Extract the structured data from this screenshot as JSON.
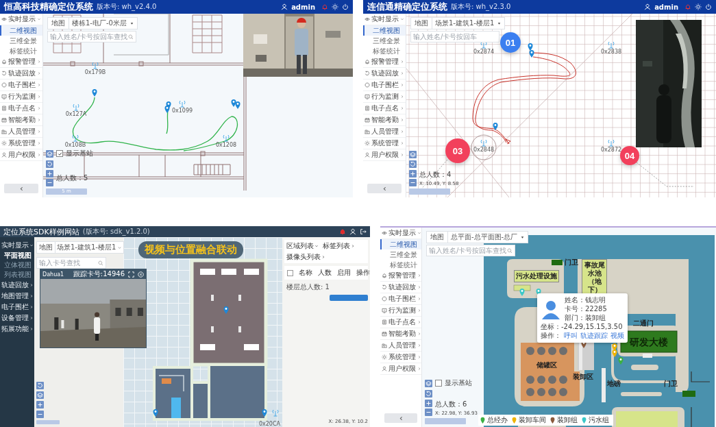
{
  "top_left": {
    "header": {
      "title": "恒高科技精确定位系统",
      "version": "版本号: wh_v2.4.0",
      "user": "admin"
    },
    "sidebar": {
      "groups": [
        {
          "label": "实时显示",
          "expanded": true,
          "children": [
            {
              "label": "二维视图",
              "selected": true
            },
            {
              "label": "三维全景",
              "selected": false
            },
            {
              "label": "标签统计",
              "selected": false
            }
          ]
        },
        {
          "label": "报警管理",
          "expanded": false
        },
        {
          "label": "轨迹回放",
          "expanded": false
        },
        {
          "label": "电子围栏",
          "expanded": false
        },
        {
          "label": "行为监测",
          "expanded": false
        },
        {
          "label": "电子点名",
          "expanded": false
        },
        {
          "label": "智能考勤",
          "expanded": false
        },
        {
          "label": "人员管理",
          "expanded": false
        },
        {
          "label": "系统管理",
          "expanded": false
        },
        {
          "label": "用户权限",
          "expanded": false
        }
      ]
    },
    "map_toolbar": {
      "label": "地图",
      "floor": "楼栋1-电厂-0米层"
    },
    "search": {
      "placeholder": "输入姓名/卡号按回车查找"
    },
    "show_anchors": {
      "label": "显示基站",
      "checked": true
    },
    "total": "总人数：5",
    "scale": "5 m",
    "anchors": [
      {
        "label": "0x179B"
      },
      {
        "label": "0x127A"
      },
      {
        "label": "0x108B"
      },
      {
        "label": "0x1099"
      },
      {
        "label": "0x1208"
      }
    ]
  },
  "top_right": {
    "header": {
      "title": "连信通精确定位系统",
      "version": "版本号: wh_v2.3.0",
      "user": "admin"
    },
    "sidebar": {
      "groups": [
        {
          "label": "实时显示",
          "expanded": true,
          "children": [
            {
              "label": "二维视图",
              "selected": true
            },
            {
              "label": "三维全景",
              "selected": false
            },
            {
              "label": "标签统计",
              "selected": false
            }
          ]
        },
        {
          "label": "报警管理",
          "expanded": false
        },
        {
          "label": "轨迹回放",
          "expanded": false
        },
        {
          "label": "电子围栏",
          "expanded": false
        },
        {
          "label": "行为监测",
          "expanded": false
        },
        {
          "label": "电子点名",
          "expanded": false
        },
        {
          "label": "智能考勤",
          "expanded": false
        },
        {
          "label": "人员管理",
          "expanded": false
        },
        {
          "label": "系统管理",
          "expanded": false
        },
        {
          "label": "用户权限",
          "expanded": false
        }
      ]
    },
    "map_toolbar": {
      "label": "地图",
      "floor": "场景1-建筑1-楼层1"
    },
    "search": {
      "placeholder": "输入姓名/卡号按回车"
    },
    "total": "总人数：4",
    "coords": "X: 10.49, Y: 8.58",
    "anchors": [
      {
        "label": "0x2874"
      },
      {
        "label": "0x2838"
      },
      {
        "label": "0x2848"
      },
      {
        "label": "0x2872"
      }
    ],
    "badges": [
      {
        "label": "01",
        "color": "#3b7ff0"
      },
      {
        "label": "03",
        "color": "#f2405c"
      },
      {
        "label": "04",
        "color": "#f2405c"
      }
    ]
  },
  "bottom_left": {
    "header": {
      "title": "定位系统SDK样例网站",
      "version": "(版本号: sdk_v1.2.0)"
    },
    "sidebar": {
      "groups": [
        {
          "label": "实时显示",
          "expanded": true,
          "children": [
            {
              "label": "平面视图",
              "selected": true
            },
            {
              "label": "立体视图",
              "selected": false
            },
            {
              "label": "列表视图",
              "selected": false
            }
          ]
        },
        {
          "label": "轨迹回放",
          "expanded": false
        },
        {
          "label": "地图管理",
          "expanded": false
        },
        {
          "label": "电子围栏",
          "expanded": false
        },
        {
          "label": "设备管理",
          "expanded": false
        },
        {
          "label": "拓展功能",
          "expanded": false
        }
      ]
    },
    "map_toolbar": {
      "label": "地图",
      "floor": "场景1-建筑1-楼层1"
    },
    "search": {
      "placeholder": "输入卡号查找"
    },
    "banner": "视频与位置融合联动",
    "video_window": {
      "camera": "Dahua1",
      "tracking": "跟踪卡号:14946"
    },
    "side_panel": {
      "tabs": [
        {
          "label": "区域列表",
          "expanded": true
        },
        {
          "label": "标签列表",
          "expanded": false
        },
        {
          "label": "摄像头列表",
          "expanded": false
        }
      ],
      "select_all": {
        "checked": false
      },
      "columns": [
        "名称",
        "人数",
        "启用",
        "操作"
      ],
      "floor_total": "楼层总人数: 1"
    },
    "anchors": [
      {
        "label": "0x20CA"
      }
    ],
    "coords": "X: 26.38, Y: 10.2"
  },
  "bottom_right": {
    "sidebar": {
      "groups": [
        {
          "label": "实时显示",
          "expanded": true,
          "children": [
            {
              "label": "二维视图",
              "selected": true
            },
            {
              "label": "三维全景",
              "selected": false
            },
            {
              "label": "标签统计",
              "selected": false
            }
          ]
        },
        {
          "label": "报警管理",
          "expanded": false
        },
        {
          "label": "轨迹回放",
          "expanded": false
        },
        {
          "label": "电子围栏",
          "expanded": false
        },
        {
          "label": "行为监测",
          "expanded": false
        },
        {
          "label": "电子点名",
          "expanded": false
        },
        {
          "label": "智能考勤",
          "expanded": false
        },
        {
          "label": "人员管理",
          "expanded": false
        },
        {
          "label": "系统管理",
          "expanded": false
        },
        {
          "label": "用户权限",
          "expanded": false
        }
      ]
    },
    "map_toolbar": {
      "label": "地图",
      "floor": "总平面-总平面图-总厂"
    },
    "search": {
      "placeholder": "输入姓名/卡号按回车查找"
    },
    "show_anchors": {
      "label": "显示基站",
      "checked": false
    },
    "total": "总人数：6",
    "coords": "X: 22.98, Y: 36.93",
    "map_labels": [
      {
        "label": "污水处理设施",
        "kind": "facility"
      },
      {
        "label": "门卫",
        "kind": "text"
      },
      {
        "label": "事故尾水池（地下）",
        "kind": "facility"
      },
      {
        "label": "储罐区",
        "kind": "text"
      },
      {
        "label": "装卸区",
        "kind": "text"
      },
      {
        "label": "地磅",
        "kind": "text"
      },
      {
        "label": "二通门",
        "kind": "text"
      },
      {
        "label": "研发大楼",
        "kind": "building"
      },
      {
        "label": "门卫",
        "kind": "text"
      }
    ],
    "popup": {
      "lines": [
        "姓名：钱志明",
        "卡号：22285",
        "部门：装卸组",
        "坐标：-24.29,15.15,3.50"
      ],
      "action_label": "操作：",
      "actions": [
        "呼叫",
        "轨迹跟踪",
        "视频"
      ]
    },
    "legend": [
      {
        "label": "总经办",
        "color": "#3cb043"
      },
      {
        "label": "装卸车间",
        "color": "#f0b400"
      },
      {
        "label": "装卸组",
        "color": "#8a5a3c"
      },
      {
        "label": "污水组",
        "color": "#3cc8c8"
      }
    ]
  }
}
